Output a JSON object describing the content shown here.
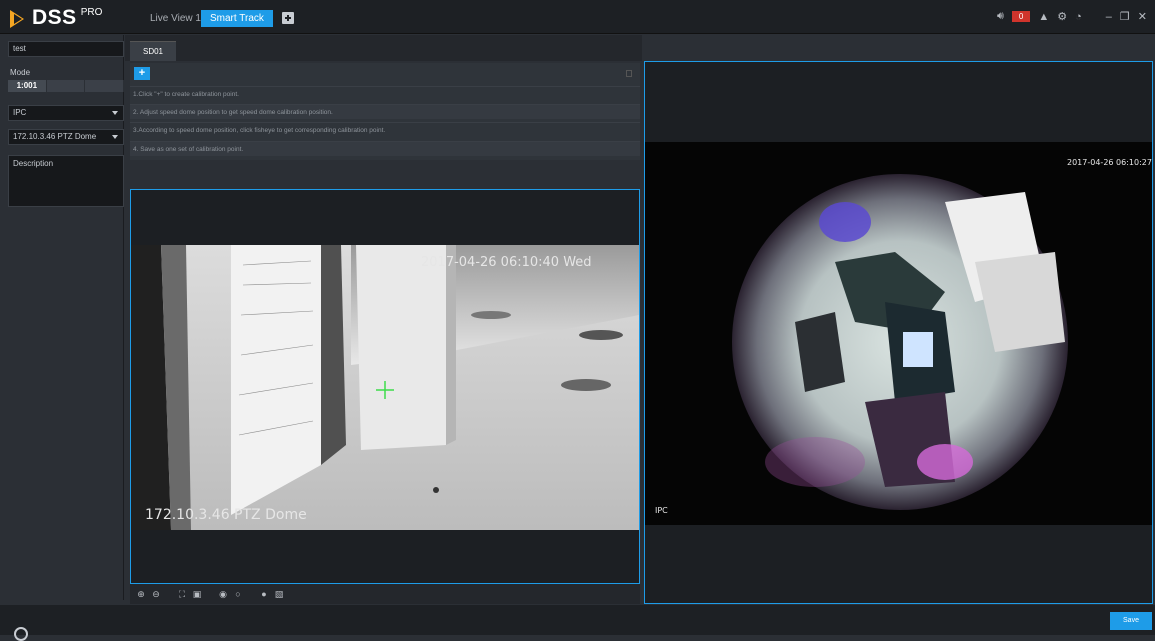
{
  "app": {
    "logo_text": "DSS",
    "logo_sup": "PRO"
  },
  "top_tabs": [
    {
      "label": "Live View 1"
    },
    {
      "label": "Smart Track"
    }
  ],
  "top_right": {
    "alarm_count": "0"
  },
  "sidebar": {
    "name_value": "test",
    "mode_label": "Mode",
    "mode_options": [
      "1:001",
      "",
      ""
    ],
    "device_type": "IPC",
    "device_name": "172.10.3.46 PTZ Dome",
    "description_label": "Description"
  },
  "center": {
    "tab_label": "SD01",
    "add_label": "+",
    "instructions": [
      "1.Click \"+\" to create calibration point.",
      "2. Adjust speed dome position to get speed dome calibration position.",
      "3.According to speed dome position, click fisheye to get corresponding calibration point.",
      "4. Save as one set of calibration point."
    ]
  },
  "left_video": {
    "timestamp_osd": "2017-04-26 06:10:40 Wed",
    "channel_osd": "172.10.3.46 PTZ Dome"
  },
  "toolbar_icons": [
    "zoom-in-icon",
    "zoom-out-icon",
    "expand-icon",
    "fit-icon",
    "focus-near-icon",
    "focus-far-icon",
    "iris-icon",
    "snapshot-icon"
  ],
  "right_video": {
    "timestamp_osd": "2017-04-26 06:10:27",
    "channel_osd": "IPC"
  },
  "footer": {
    "save_label": "Save"
  },
  "colors": {
    "accent": "#1e9ce8",
    "alarm": "#d0342c",
    "logo": "#f5a623",
    "crosshair": "#3ddc4a"
  }
}
